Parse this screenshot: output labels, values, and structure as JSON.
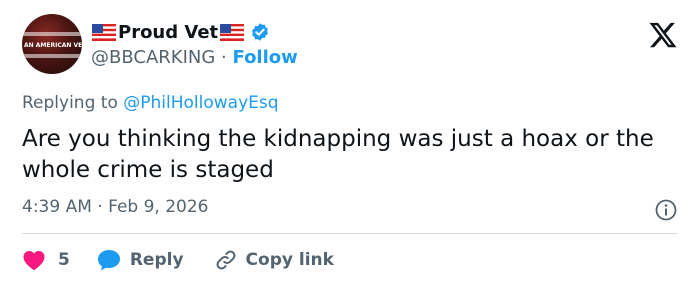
{
  "author": {
    "display_name": "Proud Vet",
    "handle": "@BBCARKING",
    "separator": "·",
    "follow_label": "Follow",
    "avatar_text": "AN AMERICAN VETERAN"
  },
  "reply_context": {
    "prefix": "Replying to",
    "mention": "@PhilHollowayEsq"
  },
  "tweet": {
    "text": "Are you thinking the kidnapping was just a hoax or the whole crime is staged",
    "time": "4:39 AM",
    "separator": "·",
    "date": "Feb 9, 2026"
  },
  "actions": {
    "like_count": "5",
    "reply_label": "Reply",
    "copy_link_label": "Copy link"
  },
  "colors": {
    "accent": "#1d9bf0",
    "like": "#f91880",
    "text": "#0f1419",
    "muted": "#536471"
  },
  "icons": [
    "us-flag-icon",
    "verified-badge-icon",
    "x-logo-icon",
    "info-icon",
    "heart-icon",
    "reply-bubble-icon",
    "link-icon"
  ]
}
